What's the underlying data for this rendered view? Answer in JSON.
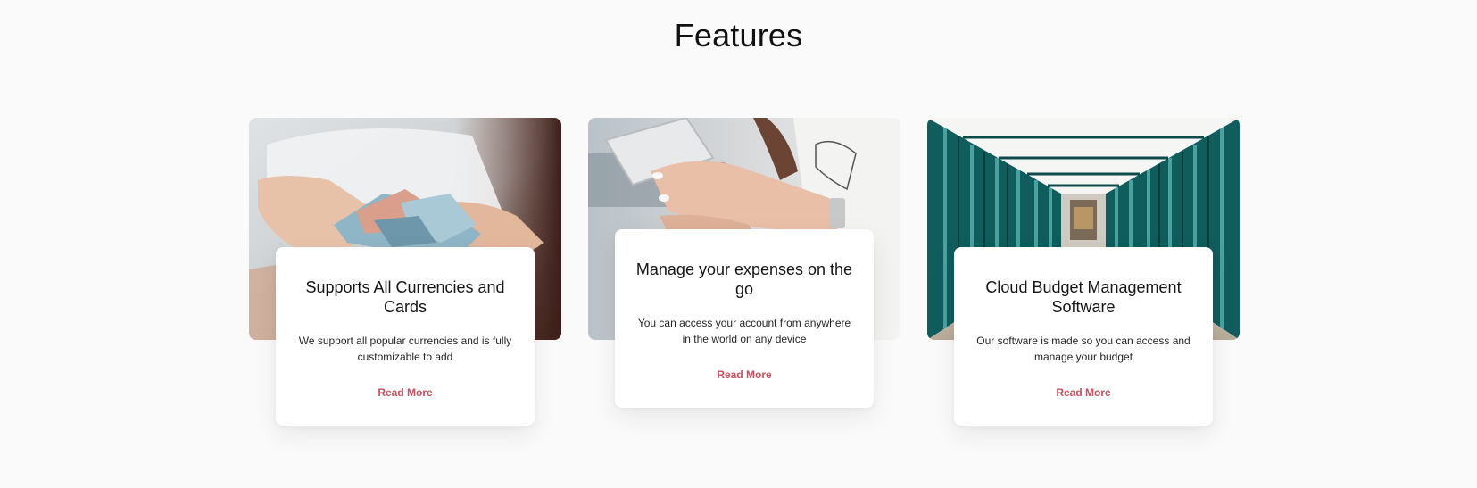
{
  "section": {
    "title": "Features"
  },
  "cards": [
    {
      "image": "cash-in-hands-photo",
      "title": "Supports All Currencies and Cards",
      "text": "We support all popular currencies and is fully customizable to add",
      "link": "Read More"
    },
    {
      "image": "phone-in-hands-photo",
      "title": "Manage your expenses on the go",
      "text": "You can access your account from anywhere in the world on any device",
      "link": "Read More"
    },
    {
      "image": "glass-corridor-photo",
      "title": "Cloud Budget Management Software",
      "text": "Our software is made so you can access and manage your budget",
      "link": "Read More"
    }
  ],
  "colors": {
    "background": "#fafafa",
    "link": "#c9505e"
  }
}
